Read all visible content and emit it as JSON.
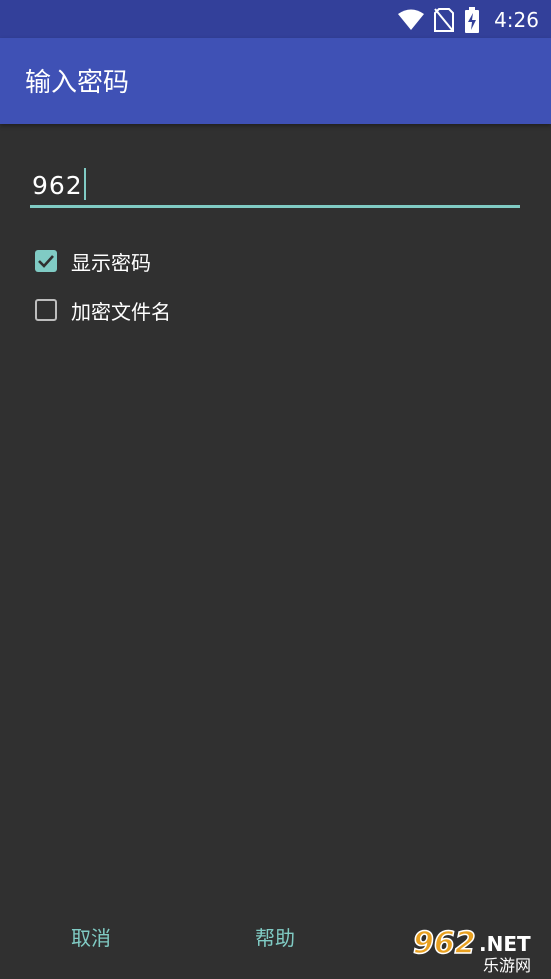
{
  "status_bar": {
    "time": "4:26",
    "icons": [
      "wifi-icon",
      "no-sim-icon",
      "battery-charging-icon"
    ]
  },
  "app_bar": {
    "title": "输入密码"
  },
  "password_field": {
    "value": "962"
  },
  "checkboxes": [
    {
      "label": "显示密码",
      "checked": true
    },
    {
      "label": "加密文件名",
      "checked": false
    }
  ],
  "buttons": {
    "cancel": "取消",
    "help": "帮助"
  },
  "watermark": {
    "number": "962",
    "suffix": ".NET",
    "tagline": "乐游网"
  },
  "colors": {
    "background": "#303030",
    "app_bar": "#3f51b5",
    "status_bar": "#33409a",
    "accent": "#80cbc4"
  }
}
